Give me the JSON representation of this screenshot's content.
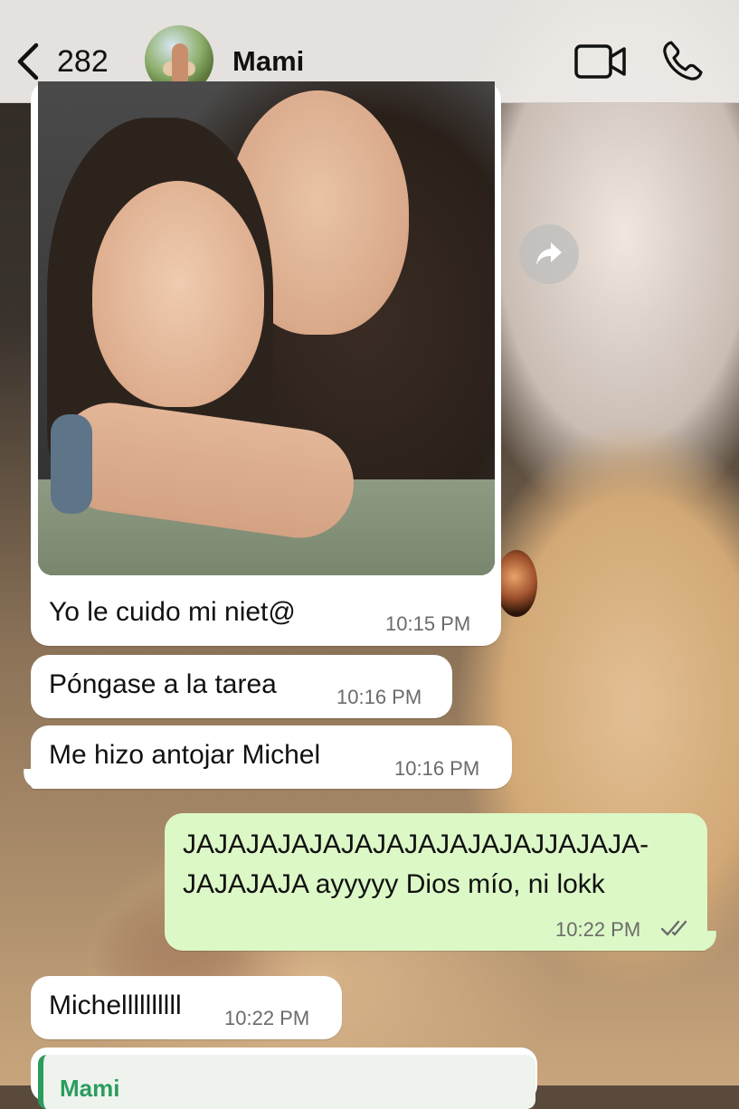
{
  "header": {
    "unread_count": "282",
    "contact_name": "Mami"
  },
  "icons": {
    "back": "chevron-left-icon",
    "video": "video-camera-icon",
    "call": "phone-icon",
    "forward": "forward-arrow-icon",
    "read_receipt": "double-check-icon"
  },
  "messages": [
    {
      "dir": "in",
      "type": "image",
      "caption": "Yo le cuido mi niet@",
      "time": "10:15 PM"
    },
    {
      "dir": "in",
      "text": "Póngase a la tarea",
      "time": "10:16 PM"
    },
    {
      "dir": "in",
      "text": "Me hizo antojar Michel",
      "time": "10:16 PM"
    },
    {
      "dir": "out",
      "text_line1": "JAJAJAJAJAJAJAJAJAJAJAJJAJAJA-",
      "text_line2": "JAJAJAJA ayyyyy Dios mío, ni lokk",
      "time": "10:22 PM"
    },
    {
      "dir": "in",
      "text": "Michellllllllll",
      "time": "10:22 PM"
    },
    {
      "dir": "in",
      "type": "reply",
      "reply_to": "Mami"
    }
  ],
  "colors": {
    "incoming_bubble": "#ffffff",
    "outgoing_bubble": "#dcf8c6",
    "reply_accent": "#2a9d5c",
    "header_bg": "#ece9e6"
  }
}
